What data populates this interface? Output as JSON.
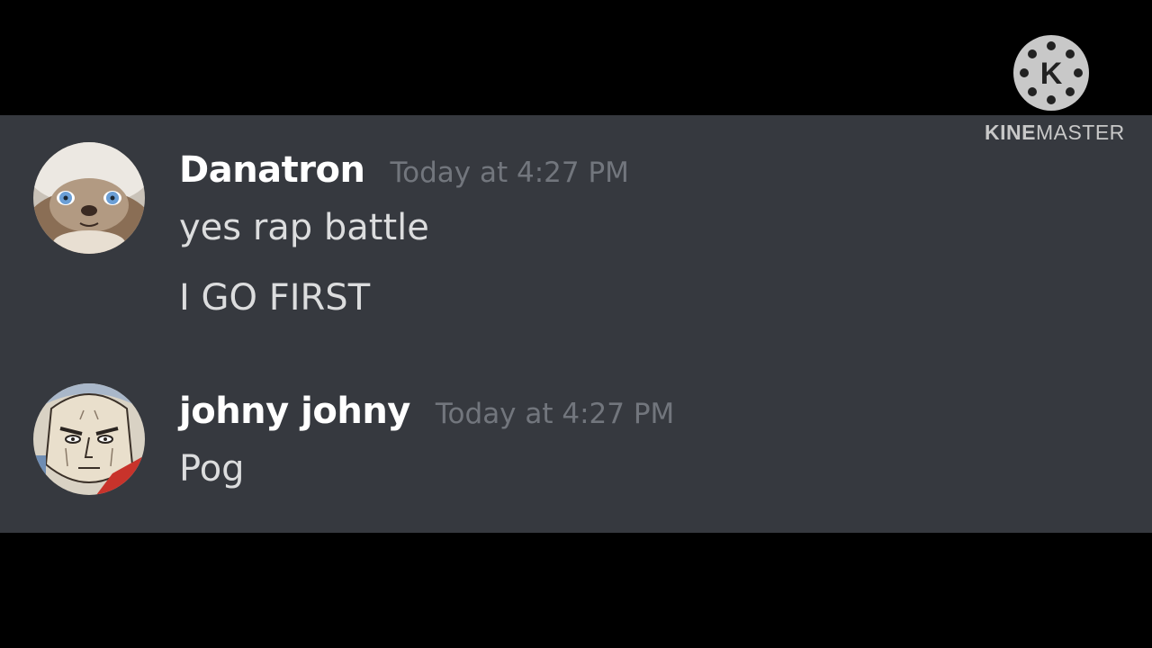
{
  "watermark": {
    "logo_letter": "K",
    "brand_bold": "KINE",
    "brand_light": "MASTER"
  },
  "messages": [
    {
      "username": "Danatron",
      "timestamp": "Today at 4:27 PM",
      "avatar_icon": "cat-avatar-icon",
      "lines": [
        "yes rap battle",
        "I GO FIRST"
      ]
    },
    {
      "username": "johny johny",
      "timestamp": "Today at 4:27 PM",
      "avatar_icon": "anime-face-avatar-icon",
      "lines": [
        "Pog"
      ]
    }
  ],
  "colors": {
    "chat_background": "#36393f",
    "letterbox": "#000000",
    "username": "#ffffff",
    "message_text": "#dcddde",
    "timestamp": "#72767d",
    "watermark": "#c8c8c8"
  }
}
